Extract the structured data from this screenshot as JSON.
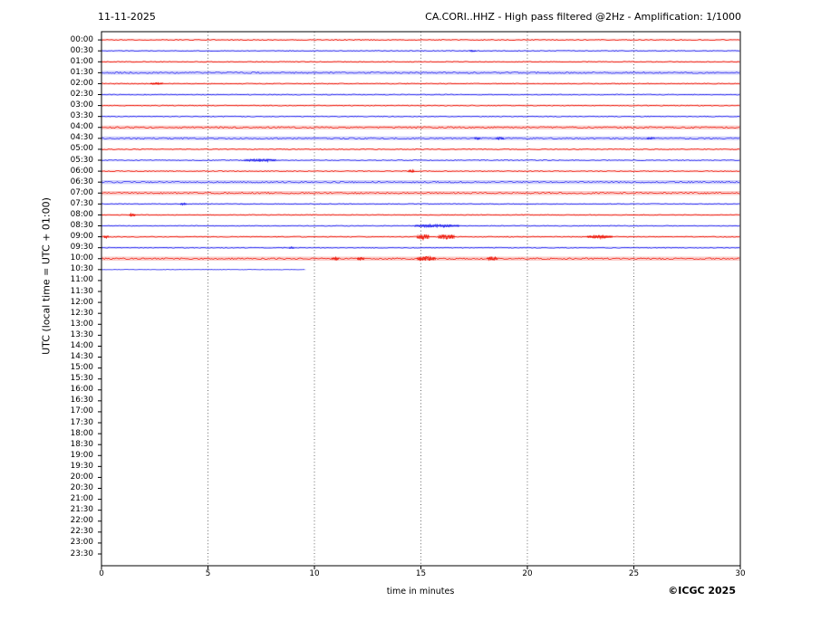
{
  "header": {
    "date": "11-11-2025",
    "title": "CA.CORI..HHZ - High pass filtered @2Hz - Amplification: 1/1000"
  },
  "footer": {
    "copyright": "©ICGC 2025"
  },
  "chart_data": {
    "type": "line",
    "subtype": "helicorder-seismogram",
    "title": "CA.CORI..HHZ - High pass filtered @2Hz - Amplification: 1/1000",
    "date": "11-11-2025",
    "xlabel": "time in minutes",
    "ylabel": "UTC (local time = UTC + 01:00)",
    "x_range": [
      0,
      30
    ],
    "x_tick_labels": [
      "0",
      "5",
      "10",
      "15",
      "20",
      "25",
      "30"
    ],
    "x_tick_values": [
      0,
      5,
      10,
      15,
      20,
      25,
      30
    ],
    "x_grid_values": [
      5,
      10,
      15,
      20,
      25
    ],
    "grid": "vertical-dotted",
    "minutes_per_row": 30,
    "colors": {
      "red": "#ee2013",
      "blue": "#3434f0",
      "grid": "#444444",
      "frame": "#000000",
      "text": "#000000",
      "background": "#ffffff"
    },
    "rows": [
      {
        "label": "00:00",
        "color": "red",
        "end": 30,
        "noise": 2,
        "events": []
      },
      {
        "label": "00:30",
        "color": "blue",
        "end": 30,
        "noise": 2,
        "events": [
          {
            "t0": 17.3,
            "t1": 17.6,
            "amp": 0.9
          }
        ]
      },
      {
        "label": "01:00",
        "color": "red",
        "end": 30,
        "noise": 2,
        "events": []
      },
      {
        "label": "01:30",
        "color": "blue",
        "end": 30,
        "noise": 3,
        "events": []
      },
      {
        "label": "02:00",
        "color": "red",
        "end": 30,
        "noise": 2,
        "events": [
          {
            "t0": 2.3,
            "t1": 2.9,
            "amp": 1.0
          }
        ]
      },
      {
        "label": "02:30",
        "color": "blue",
        "end": 30,
        "noise": 2,
        "events": []
      },
      {
        "label": "03:00",
        "color": "red",
        "end": 30,
        "noise": 2,
        "events": []
      },
      {
        "label": "03:30",
        "color": "blue",
        "end": 30,
        "noise": 2,
        "events": []
      },
      {
        "label": "04:00",
        "color": "red",
        "end": 30,
        "noise": 3,
        "events": []
      },
      {
        "label": "04:30",
        "color": "blue",
        "end": 30,
        "noise": 3,
        "events": [
          {
            "t0": 17.5,
            "t1": 17.8,
            "amp": 1.2
          },
          {
            "t0": 18.5,
            "t1": 18.9,
            "amp": 1.4
          },
          {
            "t0": 25.6,
            "t1": 26.0,
            "amp": 1.2
          }
        ]
      },
      {
        "label": "05:00",
        "color": "red",
        "end": 30,
        "noise": 2,
        "events": []
      },
      {
        "label": "05:30",
        "color": "blue",
        "end": 30,
        "noise": 2,
        "events": [
          {
            "t0": 6.7,
            "t1": 8.2,
            "amp": 1.7
          }
        ]
      },
      {
        "label": "06:00",
        "color": "red",
        "end": 30,
        "noise": 2,
        "events": [
          {
            "t0": 14.4,
            "t1": 14.7,
            "amp": 1.8
          }
        ]
      },
      {
        "label": "06:30",
        "color": "blue",
        "end": 30,
        "noise": 3,
        "events": []
      },
      {
        "label": "07:00",
        "color": "red",
        "end": 30,
        "noise": 3,
        "events": []
      },
      {
        "label": "07:30",
        "color": "blue",
        "end": 30,
        "noise": 2,
        "events": [
          {
            "t0": 3.7,
            "t1": 4.0,
            "amp": 1.2
          }
        ]
      },
      {
        "label": "08:00",
        "color": "red",
        "end": 30,
        "noise": 2,
        "events": [
          {
            "t0": 1.3,
            "t1": 1.6,
            "amp": 1.5
          }
        ]
      },
      {
        "label": "08:30",
        "color": "blue",
        "end": 30,
        "noise": 2,
        "events": [
          {
            "t0": 14.7,
            "t1": 16.8,
            "amp": 1.5
          }
        ]
      },
      {
        "label": "09:00",
        "color": "red",
        "end": 30,
        "noise": 2,
        "events": [
          {
            "t0": 0.1,
            "t1": 0.35,
            "amp": 1.5
          },
          {
            "t0": 14.8,
            "t1": 15.4,
            "amp": 3.0
          },
          {
            "t0": 15.8,
            "t1": 16.6,
            "amp": 3.0
          },
          {
            "t0": 22.8,
            "t1": 24.0,
            "amp": 1.7
          }
        ]
      },
      {
        "label": "09:30",
        "color": "blue",
        "end": 30,
        "noise": 2,
        "events": [
          {
            "t0": 8.8,
            "t1": 9.05,
            "amp": 1.2
          }
        ]
      },
      {
        "label": "10:00",
        "color": "red",
        "end": 30,
        "noise": 3,
        "events": [
          {
            "t0": 10.8,
            "t1": 11.15,
            "amp": 1.8
          },
          {
            "t0": 12.0,
            "t1": 12.35,
            "amp": 1.8
          },
          {
            "t0": 14.8,
            "t1": 15.7,
            "amp": 2.4
          },
          {
            "t0": 18.1,
            "t1": 18.6,
            "amp": 2.0
          }
        ]
      },
      {
        "label": "10:30",
        "color": "blue",
        "end": 9.6,
        "noise": 1,
        "events": []
      },
      {
        "label": "11:00",
        "color": "red",
        "end": null,
        "noise": 0,
        "events": []
      },
      {
        "label": "11:30",
        "color": "blue",
        "end": null,
        "noise": 0,
        "events": []
      },
      {
        "label": "12:00",
        "color": "red",
        "end": null,
        "noise": 0,
        "events": []
      },
      {
        "label": "12:30",
        "color": "blue",
        "end": null,
        "noise": 0,
        "events": []
      },
      {
        "label": "13:00",
        "color": "red",
        "end": null,
        "noise": 0,
        "events": []
      },
      {
        "label": "13:30",
        "color": "blue",
        "end": null,
        "noise": 0,
        "events": []
      },
      {
        "label": "14:00",
        "color": "red",
        "end": null,
        "noise": 0,
        "events": []
      },
      {
        "label": "14:30",
        "color": "blue",
        "end": null,
        "noise": 0,
        "events": []
      },
      {
        "label": "15:00",
        "color": "red",
        "end": null,
        "noise": 0,
        "events": []
      },
      {
        "label": "15:30",
        "color": "blue",
        "end": null,
        "noise": 0,
        "events": []
      },
      {
        "label": "16:00",
        "color": "red",
        "end": null,
        "noise": 0,
        "events": []
      },
      {
        "label": "16:30",
        "color": "blue",
        "end": null,
        "noise": 0,
        "events": []
      },
      {
        "label": "17:00",
        "color": "red",
        "end": null,
        "noise": 0,
        "events": []
      },
      {
        "label": "17:30",
        "color": "blue",
        "end": null,
        "noise": 0,
        "events": []
      },
      {
        "label": "18:00",
        "color": "red",
        "end": null,
        "noise": 0,
        "events": []
      },
      {
        "label": "18:30",
        "color": "blue",
        "end": null,
        "noise": 0,
        "events": []
      },
      {
        "label": "19:00",
        "color": "red",
        "end": null,
        "noise": 0,
        "events": []
      },
      {
        "label": "19:30",
        "color": "blue",
        "end": null,
        "noise": 0,
        "events": []
      },
      {
        "label": "20:00",
        "color": "red",
        "end": null,
        "noise": 0,
        "events": []
      },
      {
        "label": "20:30",
        "color": "blue",
        "end": null,
        "noise": 0,
        "events": []
      },
      {
        "label": "21:00",
        "color": "red",
        "end": null,
        "noise": 0,
        "events": []
      },
      {
        "label": "21:30",
        "color": "blue",
        "end": null,
        "noise": 0,
        "events": []
      },
      {
        "label": "22:00",
        "color": "red",
        "end": null,
        "noise": 0,
        "events": []
      },
      {
        "label": "22:30",
        "color": "blue",
        "end": null,
        "noise": 0,
        "events": []
      },
      {
        "label": "23:00",
        "color": "red",
        "end": null,
        "noise": 0,
        "events": []
      },
      {
        "label": "23:30",
        "color": "blue",
        "end": null,
        "noise": 0,
        "events": []
      }
    ]
  }
}
